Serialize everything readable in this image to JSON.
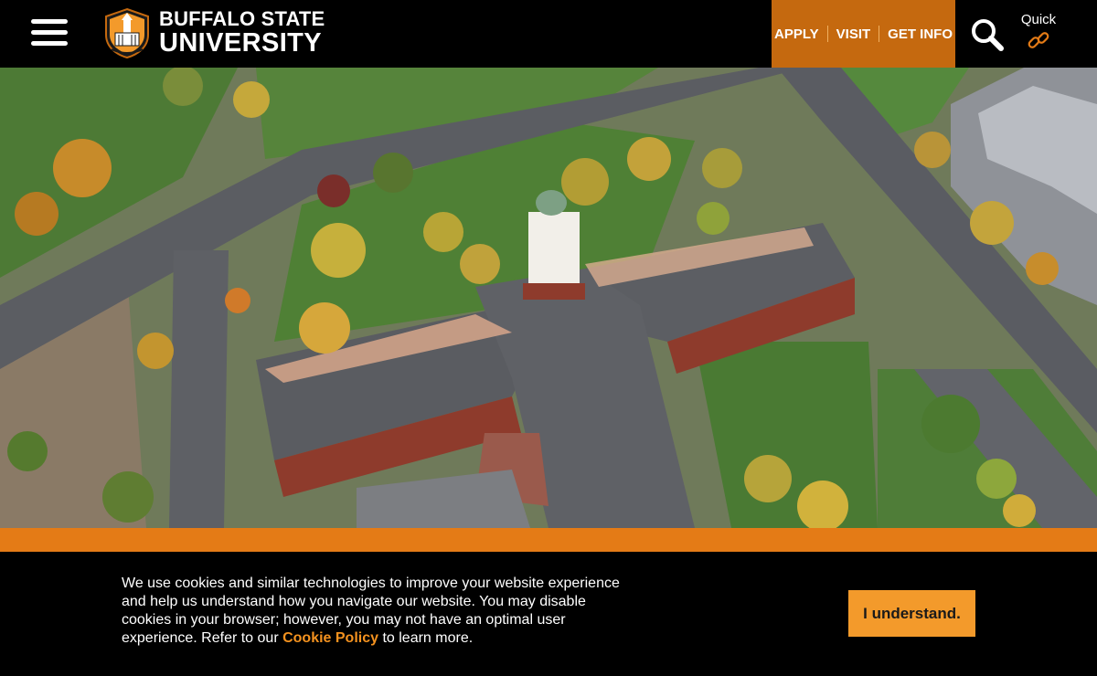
{
  "header": {
    "logo_line1": "BUFFALO STATE",
    "logo_line2": "UNIVERSITY",
    "cta": [
      {
        "label": "APPLY"
      },
      {
        "label": "VISIT"
      },
      {
        "label": "GET INFO"
      }
    ],
    "quick_label": "Quick"
  },
  "cookie": {
    "text_before": "We use cookies and similar technologies to improve your website experience and help us understand how you navigate our website. You may disable cookies in your browser; however, you may not have an optimal user experience. Refer to our ",
    "link_label": "Cookie Policy",
    "text_after": " to learn more.",
    "button_label": "I understand."
  },
  "colors": {
    "header_bg": "#000000",
    "cta_bg": "#c5690f",
    "accent_orange": "#e47b16",
    "button_bg": "#f39a2b",
    "link_orange": "#f4921f"
  },
  "icons": {
    "menu": "hamburger-icon",
    "logo": "university-seal-icon",
    "search": "search-icon",
    "quick": "link-icon"
  }
}
